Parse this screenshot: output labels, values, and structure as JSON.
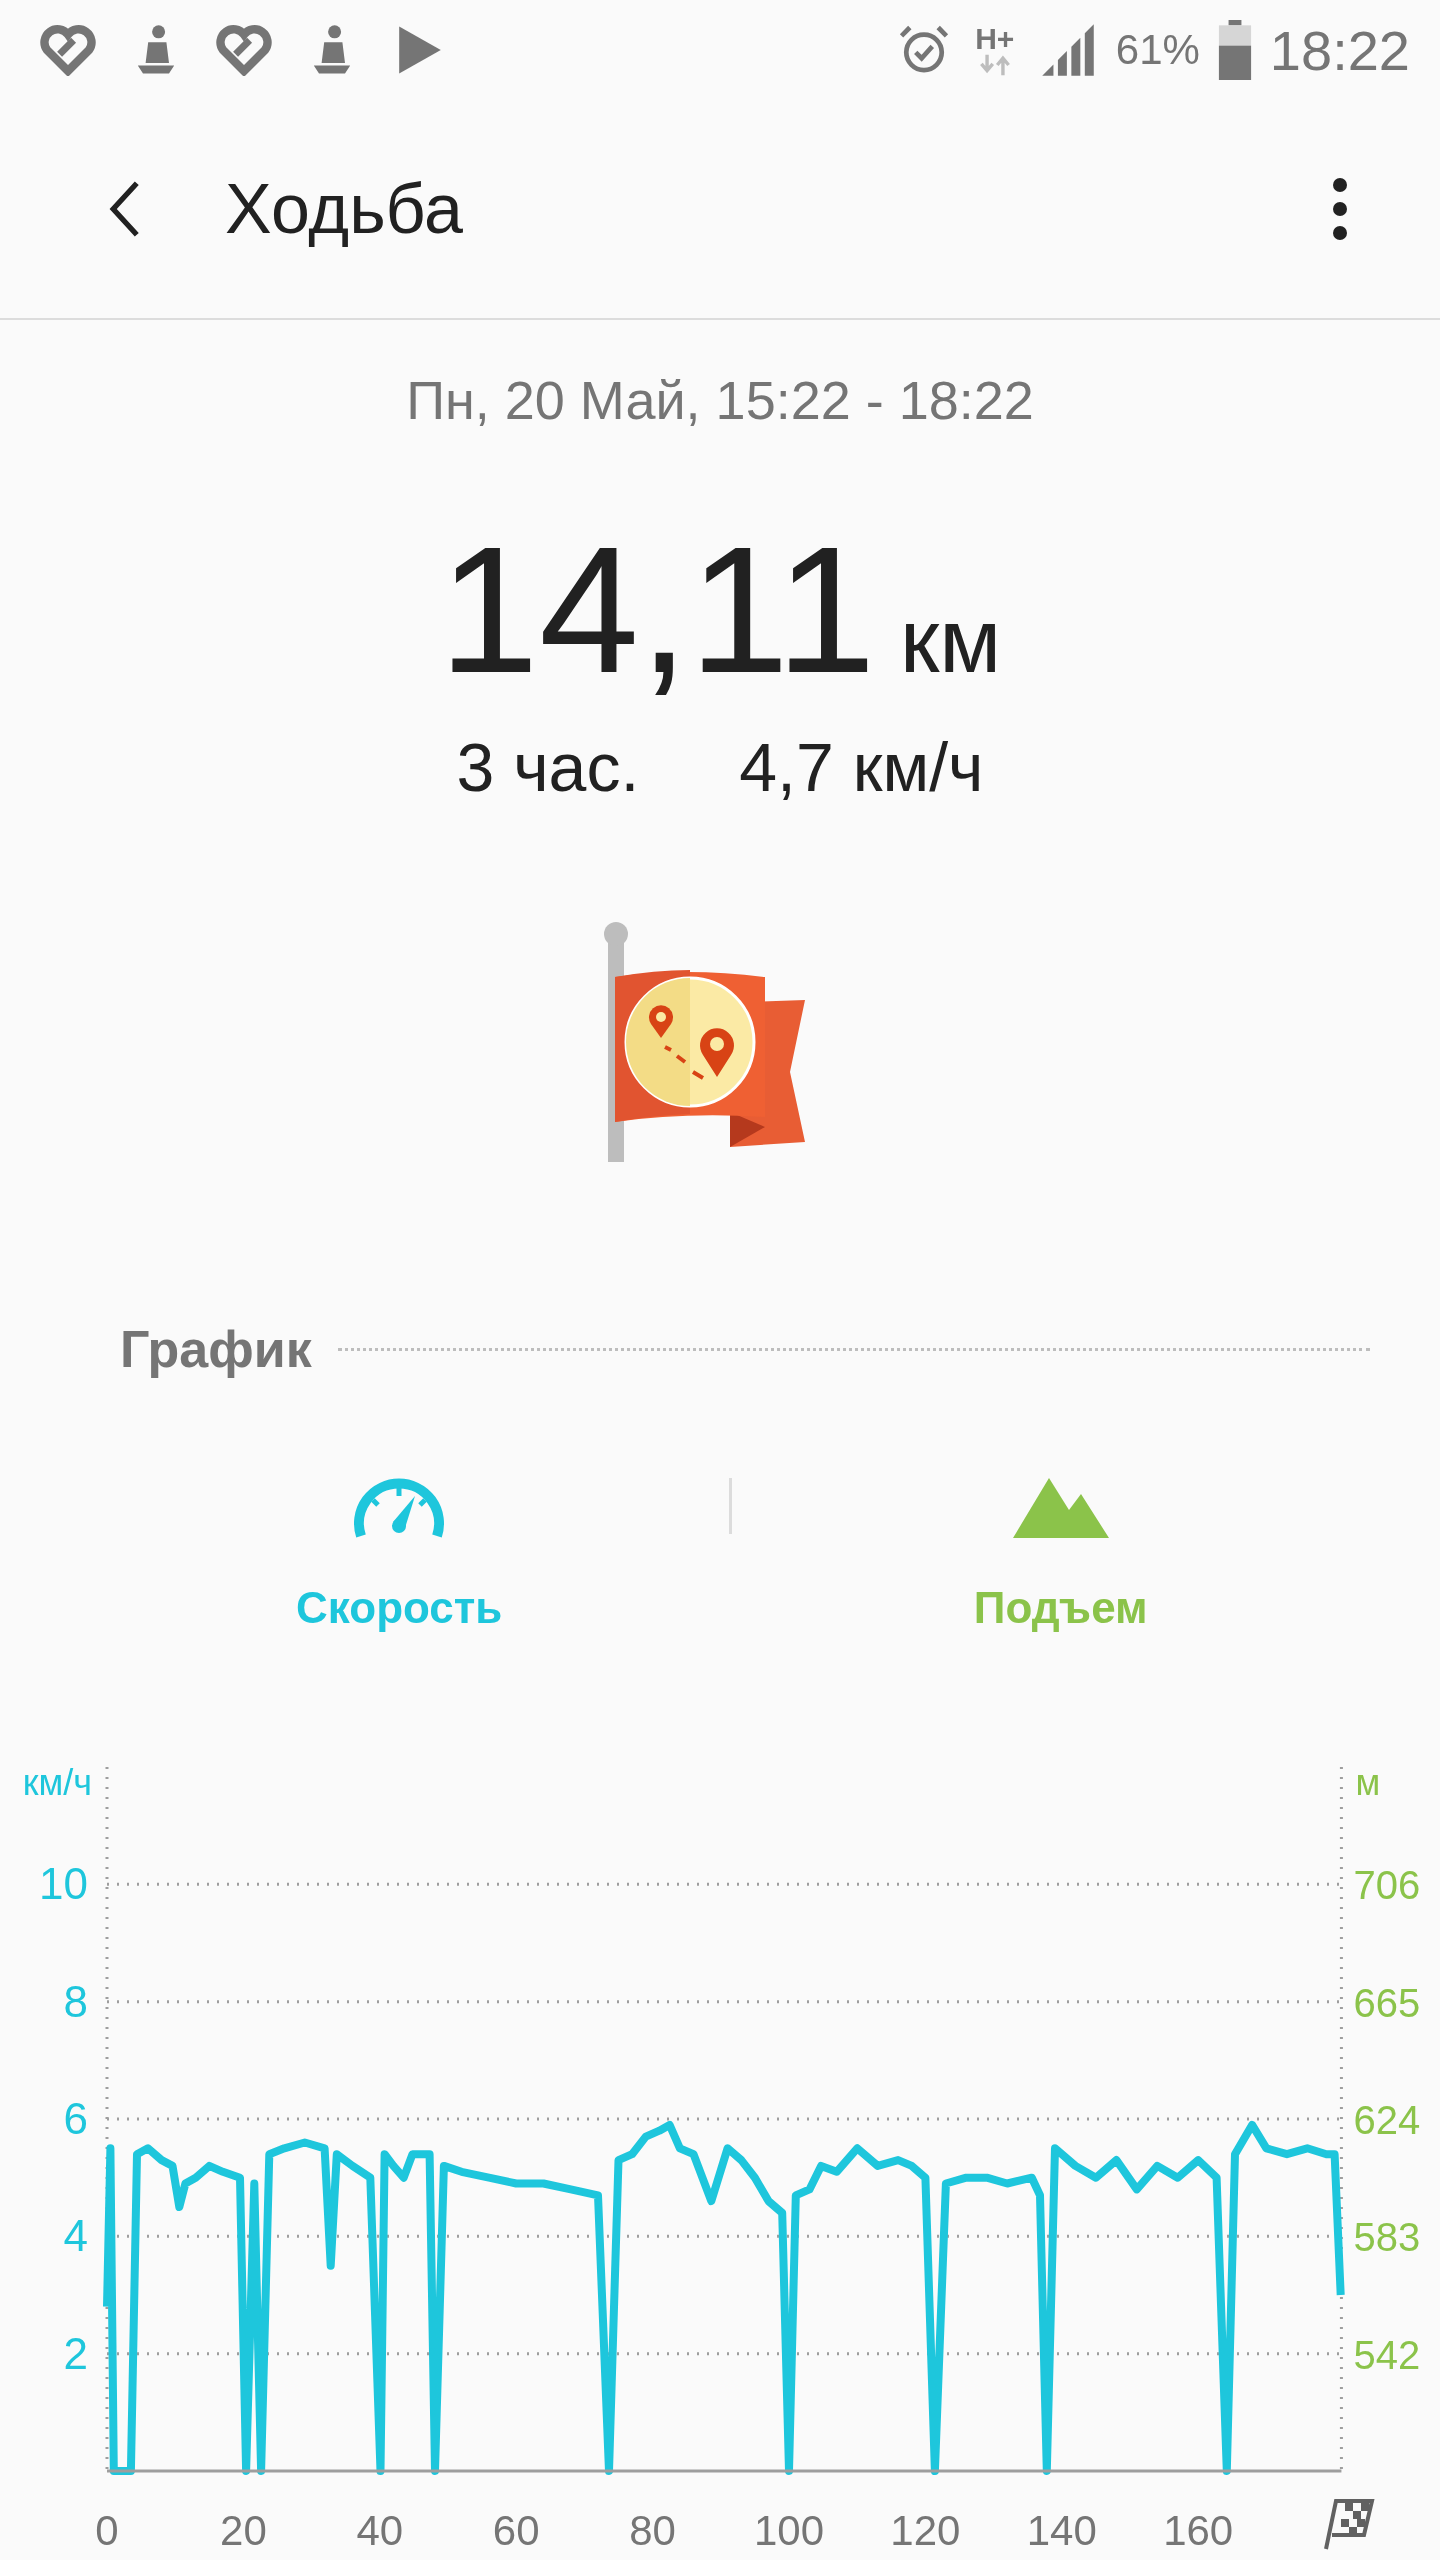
{
  "status_bar": {
    "network": "H+",
    "battery": "61%",
    "time": "18:22"
  },
  "header": {
    "title": "Ходьба"
  },
  "summary": {
    "date": "Пн, 20 Май, 15:22 - 18:22",
    "distance": "14,11",
    "distance_unit": "км",
    "duration": "3 час.",
    "speed": "4,7 км/ч"
  },
  "section": {
    "title": "График"
  },
  "tabs": [
    {
      "label": "Скорость",
      "kind": "speed",
      "selected": true,
      "color": "#1ec6dc"
    },
    {
      "label": "Подъем",
      "kind": "elevation",
      "selected": true,
      "color": "#8bc34a"
    }
  ],
  "right_axis": {
    "unit": "м",
    "ticks": [
      "706",
      "665",
      "624",
      "583",
      "542"
    ]
  },
  "chart_data": {
    "type": "line",
    "ylabel": "км/ч",
    "grid": true,
    "xlim": [
      0,
      181
    ],
    "ylim": [
      0,
      12
    ],
    "xticks": [
      0,
      20,
      40,
      60,
      80,
      100,
      120,
      140,
      160
    ],
    "yticks": [
      2,
      4,
      6,
      8,
      10
    ],
    "x": [
      0,
      0.5,
      1,
      3.5,
      4.4,
      6,
      8,
      9.6,
      10.6,
      11.5,
      13,
      15,
      17,
      19.5,
      20.4,
      21.6,
      22.6,
      23.8,
      26,
      29,
      31.9,
      32.8,
      33.7,
      36,
      38.6,
      40.1,
      40.7,
      42,
      43.5,
      44.8,
      47.3,
      48.1,
      49.4,
      52,
      56,
      60,
      64,
      68,
      72,
      73.6,
      75,
      77,
      79,
      81,
      82.5,
      84,
      86,
      88.6,
      91,
      93,
      95,
      97,
      99,
      100,
      101,
      103,
      104.7,
      107,
      110,
      113,
      116,
      118,
      120,
      121.4,
      123,
      126,
      129,
      132,
      135.6,
      136.8,
      137.8,
      139,
      142,
      145,
      148,
      151,
      154,
      157,
      160,
      162.7,
      164.2,
      165.4,
      167.9,
      170,
      173,
      176,
      178.8,
      180,
      180.9
    ],
    "series": [
      {
        "color": "#1ec6dc",
        "values": [
          2.8,
          5.5,
          0,
          0,
          5.4,
          5.5,
          5.3,
          5.2,
          4.5,
          4.9,
          5.0,
          5.2,
          5.1,
          5.0,
          0,
          4.9,
          0,
          5.4,
          5.5,
          5.6,
          5.5,
          3.5,
          5.4,
          5.2,
          5.0,
          0,
          5.4,
          5.2,
          5.0,
          5.4,
          5.4,
          0,
          5.2,
          5.1,
          5.0,
          4.9,
          4.9,
          4.8,
          4.7,
          0,
          5.3,
          5.4,
          5.7,
          5.8,
          5.9,
          5.5,
          5.4,
          4.6,
          5.5,
          5.3,
          5.0,
          4.6,
          4.4,
          0,
          4.7,
          4.8,
          5.2,
          5.1,
          5.5,
          5.2,
          5.3,
          5.2,
          5.0,
          0,
          4.9,
          5.0,
          5.0,
          4.9,
          5.0,
          4.7,
          0,
          5.5,
          5.2,
          5.0,
          5.3,
          4.8,
          5.2,
          5.0,
          5.3,
          5.0,
          0,
          5.4,
          5.9,
          5.5,
          5.4,
          5.5,
          5.4,
          5.4,
          3.0
        ]
      }
    ]
  }
}
